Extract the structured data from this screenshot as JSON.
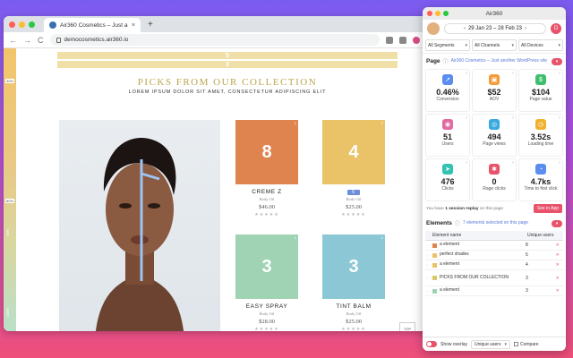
{
  "browser": {
    "tab_title": "Air360 Cosmetics – Just anoth",
    "tab_close": "×",
    "new_tab": "+",
    "url": "democosmetics.air360.io",
    "nav_back": "←",
    "nav_forward": "→",
    "nav_reload": "C"
  },
  "page": {
    "overlay_label_1": "5",
    "overlay_label_2": "3",
    "headline": "PICKS FROM OUR COLLECTION",
    "subline": "LOREM IPSUM DOLOR SIT AMET, CONSECTETUR ADIPISCING ELIT",
    "top_button": "TOP",
    "ruler": {
      "top_pct": "30%",
      "mid_pct": "80%",
      "mid_label": "60%",
      "bottom_label": "100%"
    },
    "products": [
      {
        "name": "CREME Z",
        "category": "Body Oil",
        "price": "$46.00",
        "count": "8",
        "stars": "★★★★★",
        "color": "#e0844f",
        "tag": "1"
      },
      {
        "name": "",
        "category": "Body Oil",
        "price": "$25.00",
        "count": "4",
        "stars": "★★★★★",
        "color": "#eac267",
        "tag": "1",
        "name_badge": "6"
      },
      {
        "name": "EASY SPRAY",
        "category": "Body Oil",
        "price": "$28.00",
        "count": "3",
        "stars": "★★★★★",
        "color": "#9fd3b3",
        "tag": "1"
      },
      {
        "name": "TINT BALM",
        "category": "Body Oil",
        "price": "$25.00",
        "count": "3",
        "stars": "★★★★★",
        "color": "#8cc7d6",
        "tag": "1"
      }
    ]
  },
  "panel": {
    "title": "Air360",
    "date_range": "29 Jan 23 – 28 Feb 23",
    "date_prev": "‹",
    "date_next": "›",
    "user_initial": "D",
    "filters": [
      "All Segments",
      "All Channels",
      "All Devices"
    ],
    "page_label": "Page",
    "page_desc": "Air360 Cosmetics – Just another WordPress site",
    "metrics": [
      {
        "value": "0.46%",
        "label": "Conversion",
        "icon": "trend-icon",
        "glyph": "↗",
        "color": "#5b8def"
      },
      {
        "value": "$52",
        "label": "AOV",
        "icon": "cart-icon",
        "glyph": "▣",
        "color": "#f39b3a"
      },
      {
        "value": "$104",
        "label": "Page value",
        "icon": "dollar-icon",
        "glyph": "$",
        "color": "#3fbf6d"
      },
      {
        "value": "51",
        "label": "Users",
        "icon": "users-icon",
        "glyph": "◉",
        "color": "#e26aa3"
      },
      {
        "value": "494",
        "label": "Page views",
        "icon": "eye-icon",
        "glyph": "◎",
        "color": "#3aa9e0"
      },
      {
        "value": "3.52s",
        "label": "Loading time",
        "icon": "clock-icon",
        "glyph": "◷",
        "color": "#f0b12e"
      },
      {
        "value": "476",
        "label": "Clicks",
        "icon": "cursor-icon",
        "glyph": "➤",
        "color": "#32c4b0"
      },
      {
        "value": "0",
        "label": "Rage clicks",
        "icon": "rage-icon",
        "glyph": "✱",
        "color": "#e8536b"
      },
      {
        "value": "4.7ks",
        "label": "Time to first click",
        "icon": "timer-icon",
        "glyph": "◔",
        "color": "#5b8def"
      }
    ],
    "replay_text_pre": "You have",
    "replay_text_bold": "1 session replay",
    "replay_text_post": "on this page",
    "replay_button": "See in App",
    "elements_label": "Elements",
    "elements_desc": "7 elements selected on this page",
    "table_headers": {
      "name": "Element name",
      "users": "Unique users"
    },
    "elements": [
      {
        "name": "a element",
        "users": "8",
        "color": "#e0844f"
      },
      {
        "name": "perfect shades",
        "users": "5",
        "color": "#eac267"
      },
      {
        "name": "a element",
        "users": "4",
        "color": "#eac267"
      },
      {
        "name": "PICKS FROM OUR COLLECTION",
        "users": "3",
        "color": "#d7c96a"
      },
      {
        "name": "a element",
        "users": "3",
        "color": "#9fd3b3"
      }
    ],
    "footer": {
      "show_overlay": "Show overlay",
      "metric_select": "Unique users",
      "compare": "Compare"
    }
  }
}
